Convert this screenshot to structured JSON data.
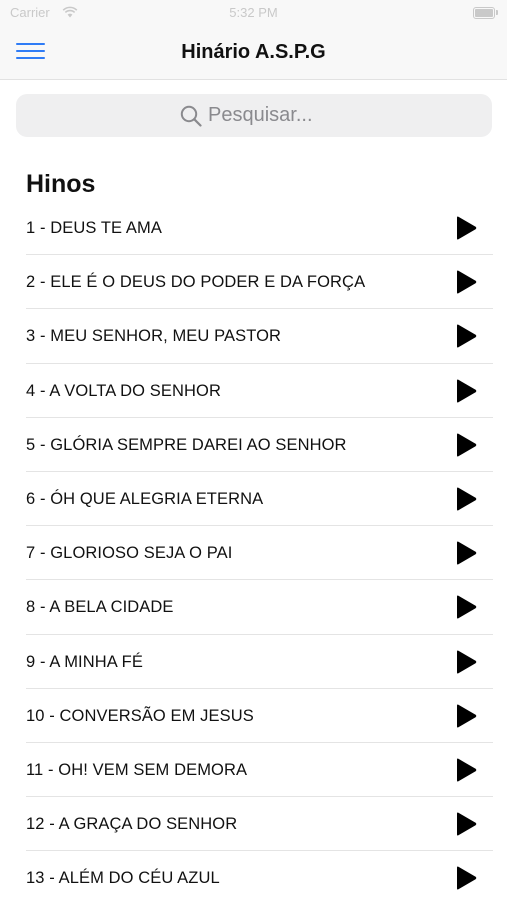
{
  "status_bar": {
    "carrier": "Carrier",
    "time": "5:32 PM"
  },
  "header": {
    "title": "Hinário A.S.P.G",
    "menu_icon": "hamburger-menu-icon",
    "accent_color": "#2f7cf6"
  },
  "search": {
    "placeholder": "Pesquisar...",
    "icon": "search-icon"
  },
  "section": {
    "title": "Hinos"
  },
  "hymns": [
    {
      "label": "1 - DEUS TE AMA"
    },
    {
      "label": "2 - ELE É O DEUS DO PODER E DA FORÇA"
    },
    {
      "label": "3 - MEU SENHOR, MEU PASTOR"
    },
    {
      "label": "4 - A VOLTA DO SENHOR"
    },
    {
      "label": "5 - GLÓRIA SEMPRE DAREI AO SENHOR"
    },
    {
      "label": "6 - ÓH QUE ALEGRIA ETERNA"
    },
    {
      "label": "7 - GLORIOSO SEJA O PAI"
    },
    {
      "label": "8 - A BELA CIDADE"
    },
    {
      "label": "9 - A MINHA FÉ"
    },
    {
      "label": "10 - CONVERSÃO EM JESUS"
    },
    {
      "label": "11 - OH! VEM SEM DEMORA"
    },
    {
      "label": "12 - A GRAÇA DO SENHOR"
    },
    {
      "label": "13 - ALÉM DO CÉU AZUL"
    }
  ],
  "play_icon": "play-icon"
}
